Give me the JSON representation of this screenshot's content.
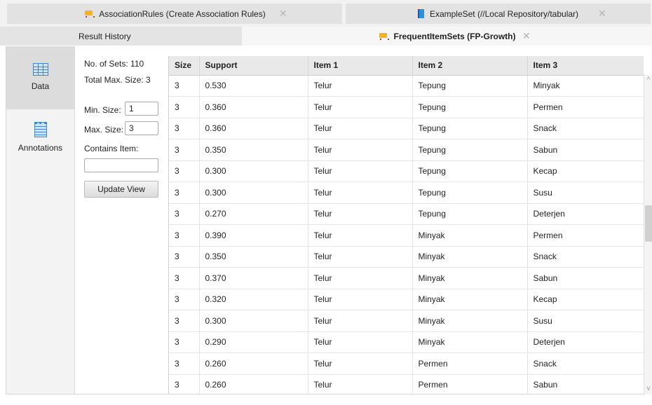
{
  "tabs_top": [
    {
      "label": "AssociationRules (Create Association Rules)",
      "icon": "cart-icon"
    },
    {
      "label": "ExampleSet (//Local Repository/tabular)",
      "icon": "book-icon"
    }
  ],
  "tabs_second": [
    {
      "label": "Result History"
    },
    {
      "label": "FrequentItemSets (FP-Growth)",
      "icon": "cart-icon"
    }
  ],
  "close_symbol": "✕",
  "sidebar": {
    "items": [
      {
        "label": "Data",
        "icon": "table-grid-icon"
      },
      {
        "label": "Annotations",
        "icon": "notepad-icon"
      }
    ]
  },
  "filters": {
    "num_sets": "No. of Sets: 110",
    "total_max": "Total Max. Size: 3",
    "min_label": "Min. Size:",
    "min_value": "1",
    "max_label": "Max. Size:",
    "max_value": "3",
    "contains_label": "Contains Item:",
    "contains_value": "",
    "update_button": "Update View"
  },
  "table": {
    "columns": [
      "Size",
      "Support",
      "Item 1",
      "Item 2",
      "Item 3"
    ],
    "rows": [
      [
        "3",
        "0.530",
        "Telur",
        "Tepung",
        "Minyak"
      ],
      [
        "3",
        "0.360",
        "Telur",
        "Tepung",
        "Permen"
      ],
      [
        "3",
        "0.360",
        "Telur",
        "Tepung",
        "Snack"
      ],
      [
        "3",
        "0.350",
        "Telur",
        "Tepung",
        "Sabun"
      ],
      [
        "3",
        "0.300",
        "Telur",
        "Tepung",
        "Kecap"
      ],
      [
        "3",
        "0.300",
        "Telur",
        "Tepung",
        "Susu"
      ],
      [
        "3",
        "0.270",
        "Telur",
        "Tepung",
        "Deterjen"
      ],
      [
        "3",
        "0.390",
        "Telur",
        "Minyak",
        "Permen"
      ],
      [
        "3",
        "0.350",
        "Telur",
        "Minyak",
        "Snack"
      ],
      [
        "3",
        "0.370",
        "Telur",
        "Minyak",
        "Sabun"
      ],
      [
        "3",
        "0.320",
        "Telur",
        "Minyak",
        "Kecap"
      ],
      [
        "3",
        "0.300",
        "Telur",
        "Minyak",
        "Susu"
      ],
      [
        "3",
        "0.290",
        "Telur",
        "Minyak",
        "Deterjen"
      ],
      [
        "3",
        "0.260",
        "Telur",
        "Permen",
        "Snack"
      ],
      [
        "3",
        "0.260",
        "Telur",
        "Permen",
        "Sabun"
      ]
    ]
  }
}
